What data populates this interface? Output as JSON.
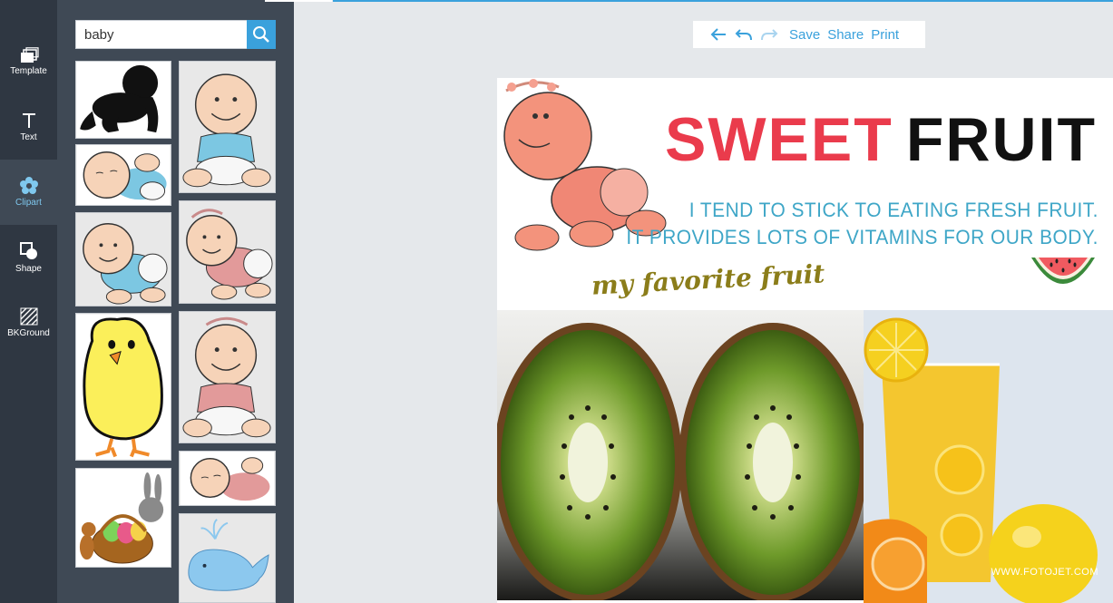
{
  "nav": {
    "items": [
      {
        "label": "Template",
        "icon": "template-icon"
      },
      {
        "label": "Text",
        "icon": "text-icon"
      },
      {
        "label": "Clipart",
        "icon": "clipart-icon",
        "active": true
      },
      {
        "label": "Shape",
        "icon": "shape-icon"
      },
      {
        "label": "BKGround",
        "icon": "background-icon"
      }
    ]
  },
  "search": {
    "value": "baby",
    "placeholder": ""
  },
  "clipart": [
    {
      "name": "crawling-baby-silhouette"
    },
    {
      "name": "sitting-baby-blue"
    },
    {
      "name": "sleeping-baby"
    },
    {
      "name": "crawling-baby-blue"
    },
    {
      "name": "crawling-baby-pink"
    },
    {
      "name": "yellow-chick"
    },
    {
      "name": "sitting-baby-pink"
    },
    {
      "name": "easter-bunny-basket"
    },
    {
      "name": "sleeping-baby-pink"
    },
    {
      "name": "blue-whale"
    }
  ],
  "toolbar": {
    "save": "Save",
    "share": "Share",
    "print": "Print"
  },
  "design": {
    "title_word1": "SWEET",
    "title_word2": "FRUIT",
    "line1": "I TEND TO STICK TO EATING FRESH FRUIT.",
    "line2": "IT PROVIDES LOTS OF VITAMINS FOR OUR BODY.",
    "script": "my favorite fruit",
    "watermark": "WWW.FOTOJET.COM"
  },
  "colors": {
    "accent": "#3aa1dc",
    "title_red": "#ea3b4c",
    "subtitle_teal": "#3ea6c7",
    "nav_bg": "#2f3742",
    "panel_bg": "#3f4955"
  }
}
